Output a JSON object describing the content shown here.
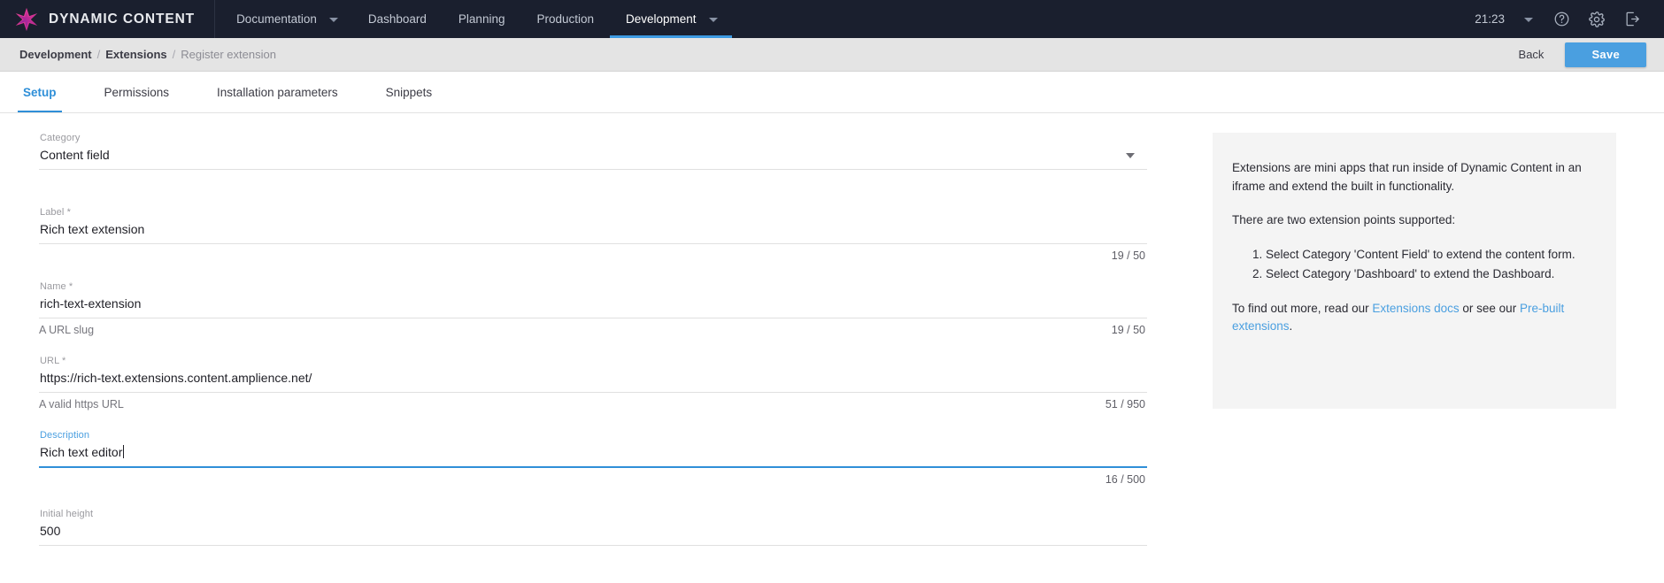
{
  "topnav": {
    "brand": "DYNAMIC CONTENT",
    "brand_logo_icon": "amplience-star-logo",
    "items": [
      {
        "label": "Documentation",
        "caret": true,
        "active": false
      },
      {
        "label": "Dashboard",
        "caret": false,
        "active": false
      },
      {
        "label": "Planning",
        "caret": false,
        "active": false
      },
      {
        "label": "Production",
        "caret": false,
        "active": false
      },
      {
        "label": "Development",
        "caret": true,
        "active": true
      }
    ],
    "clock": "21:23",
    "clock_caret_icon": "chevron-down-icon",
    "help_icon": "help-circle-icon",
    "settings_icon": "gear-icon",
    "logout_icon": "logout-icon"
  },
  "breadcrumb": {
    "items": [
      {
        "label": "Development",
        "current": false
      },
      {
        "label": "Extensions",
        "current": false
      },
      {
        "label": "Register extension",
        "current": true
      }
    ],
    "separator": "/",
    "back_label": "Back",
    "save_label": "Save"
  },
  "tabs": [
    {
      "label": "Setup",
      "active": true
    },
    {
      "label": "Permissions",
      "active": false
    },
    {
      "label": "Installation parameters",
      "active": false
    },
    {
      "label": "Snippets",
      "active": false
    }
  ],
  "form": {
    "category": {
      "label": "Category",
      "value": "Content field",
      "caret_icon": "chevron-down-icon"
    },
    "label_field": {
      "label": "Label *",
      "value": "Rich text extension",
      "counter": "19 / 50",
      "hint": ""
    },
    "name_field": {
      "label": "Name *",
      "value": "rich-text-extension",
      "hint": "A URL slug",
      "counter": "19 / 50"
    },
    "url_field": {
      "label": "URL *",
      "value": "https://rich-text.extensions.content.amplience.net/",
      "hint": "A valid https URL",
      "counter": "51 / 950"
    },
    "description_field": {
      "label": "Description",
      "value": "Rich text editor",
      "hint": "",
      "counter": "16 / 500",
      "focused": true
    },
    "initial_height_field": {
      "label": "Initial height",
      "value": "500"
    }
  },
  "info_panel": {
    "paragraph_1": "Extensions are mini apps that run inside of Dynamic Content in an iframe and extend the built in functionality.",
    "paragraph_2": "There are two extension points supported:",
    "list": [
      "Select Category 'Content Field' to extend the content form.",
      "Select Category 'Dashboard' to extend the Dashboard."
    ],
    "outro_prefix": "To find out more, read our ",
    "link_1": "Extensions docs",
    "outro_middle": " or see our ",
    "link_2": "Pre-built extensions",
    "outro_suffix": "."
  },
  "colors": {
    "accent": "#4a9fe0",
    "tab_active": "#2f8fd8",
    "nav_bg": "#1a1f2e",
    "crumbbar_bg": "#e4e4e4",
    "info_bg": "#f4f4f4"
  }
}
